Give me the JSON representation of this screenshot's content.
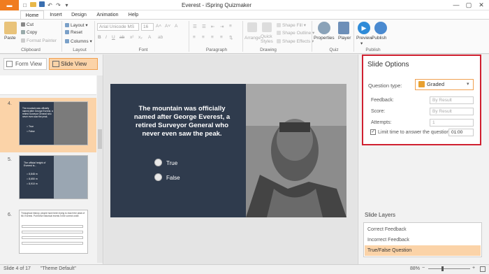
{
  "window": {
    "title": "Everest - iSpring Quizmaker",
    "file_button": "▬"
  },
  "quick_access": {
    "new_icon": "document-icon",
    "open_icon": "folder-icon",
    "save_icon": "save-icon",
    "undo_icon": "undo-icon",
    "redo_icon": "redo-icon",
    "more_icon": "chevron-down-icon"
  },
  "window_controls": {
    "minimize": "—",
    "maximize": "▢",
    "close": "✕"
  },
  "tabs": [
    "Home",
    "Insert",
    "Design",
    "Animation",
    "Help"
  ],
  "ribbon": {
    "clipboard": {
      "paste": "Paste",
      "cut": "Cut",
      "copy": "Copy",
      "format_painter": "Format Painter",
      "label": "Clipboard"
    },
    "layout": {
      "layout": "Layout",
      "reset": "Reset",
      "columns": "Columns",
      "label": "Layout"
    },
    "font": {
      "font_name": "Arial Unicode MS",
      "font_size": "16",
      "label": "Font"
    },
    "paragraph": {
      "label": "Paragraph"
    },
    "drawing": {
      "arrange": "Arrange",
      "quick_styles": "Quick Styles",
      "shape_fill": "Shape Fill",
      "shape_outline": "Shape Outline",
      "shape_effects": "Shape Effects",
      "label": "Drawing"
    },
    "quiz": {
      "properties": "Properties",
      "player": "Player",
      "label": "Quiz"
    },
    "publish": {
      "preview": "Preview",
      "publish": "Publish",
      "label": "Publish"
    }
  },
  "views": {
    "form_view": "Form View",
    "slide_view": "Slide View"
  },
  "thumbnails": [
    {
      "number": "4.",
      "text": "The mountain was officially named after George Everest, a retired Surveyor General who never even saw the peak.",
      "options": [
        "True",
        "False"
      ]
    },
    {
      "number": "5.",
      "text": "The official height of Everest is...",
      "options": [
        "8,848 m",
        "8,650 m",
        "8,910 m"
      ]
    },
    {
      "number": "6.",
      "text": "Throughout history, people have been trying to reach the peak of Mt. Everest. Put these historical events in the correct order."
    }
  ],
  "slide": {
    "question": "The mountain was officially named after George Everest, a retired Surveyor General who never even saw the peak.",
    "answers": [
      "True",
      "False"
    ]
  },
  "slide_options": {
    "title": "Slide Options",
    "question_type_label": "Question type:",
    "question_type_value": "Graded",
    "feedback_label": "Feedback:",
    "feedback_value": "By Result",
    "score_label": "Score:",
    "score_value": "By Result",
    "attempts_label": "Attempts:",
    "attempts_value": "1",
    "limit_time_label": "Limit time to answer the question:",
    "limit_time_value": "01:00"
  },
  "slide_layers": {
    "title": "Slide Layers",
    "items": [
      "Correct Feedback",
      "Incorrect Feedback",
      "True/False Question"
    ]
  },
  "status": {
    "slide_counter": "Slide 4 of 17",
    "theme": "\"Theme Default\"",
    "zoom": "88%"
  },
  "colors": {
    "accent": "#f07c1f",
    "selection": "#fbd3a8",
    "slide_bg": "#2f3b4d",
    "highlight_border": "#d02030"
  }
}
